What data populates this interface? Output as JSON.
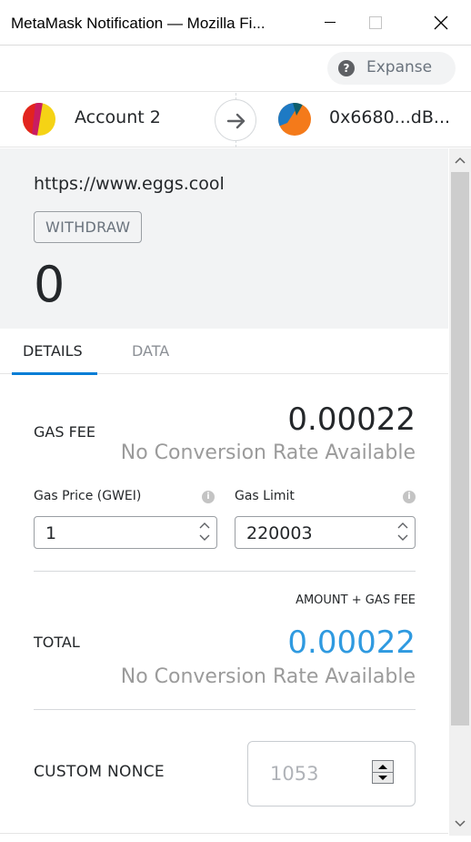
{
  "window": {
    "title": "MetaMask Notification — Mozilla Fi..."
  },
  "network": {
    "label": "Expanse",
    "icon": "help-circle-icon"
  },
  "accounts": {
    "from_name": "Account 2",
    "to_address": "0x6680...dB..."
  },
  "summary": {
    "origin": "https://www.eggs.cool",
    "method": "WITHDRAW",
    "amount": "0"
  },
  "tabs": [
    {
      "label": "DETAILS",
      "active": true
    },
    {
      "label": "DATA",
      "active": false
    }
  ],
  "gas": {
    "fee_label": "GAS FEE",
    "fee_value": "0.00022",
    "fee_conversion": "No Conversion Rate Available",
    "price_label": "Gas Price (GWEI)",
    "price_value": "1",
    "limit_label": "Gas Limit",
    "limit_value": "220003"
  },
  "total": {
    "caption": "AMOUNT + GAS FEE",
    "label": "TOTAL",
    "value": "0.00022",
    "conversion": "No Conversion Rate Available"
  },
  "nonce": {
    "label": "CUSTOM NONCE",
    "placeholder": "1053"
  },
  "colors": {
    "accent_blue": "#037dd6",
    "total_blue": "#2f9ae0",
    "summary_bg": "#f2f3f4"
  }
}
